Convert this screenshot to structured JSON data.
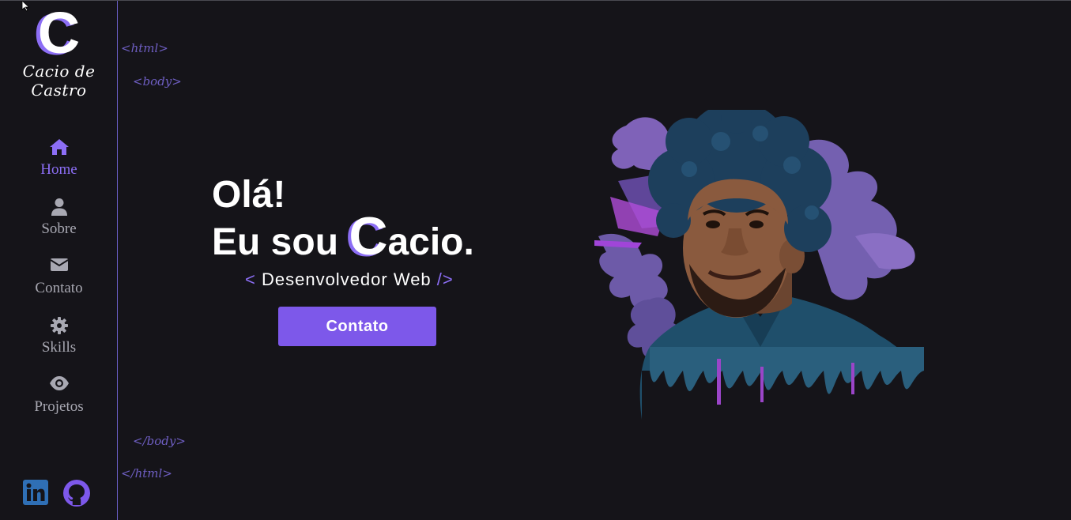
{
  "logo": {
    "letter": "C",
    "name": "Cacio de Castro"
  },
  "nav": {
    "items": [
      {
        "label": "Home",
        "icon": "home-icon",
        "active": true
      },
      {
        "label": "Sobre",
        "icon": "user-icon",
        "active": false
      },
      {
        "label": "Contato",
        "icon": "envelope-icon",
        "active": false
      },
      {
        "label": "Skills",
        "icon": "gear-icon",
        "active": false
      },
      {
        "label": "Projetos",
        "icon": "eye-icon",
        "active": false
      }
    ]
  },
  "social": {
    "linkedin_icon": "linkedin-icon",
    "github_icon": "github-icon"
  },
  "code_tags": {
    "html_open": "<html>",
    "body_open": "<body>",
    "body_close": "</body>",
    "html_close": "</html>"
  },
  "hero": {
    "line1": "Olá!",
    "line2_prefix": "Eu sou ",
    "line2_big": "C",
    "line2_suffix": "acio.",
    "subtitle_open": "< ",
    "subtitle_text": "Desenvolvedor Web",
    "subtitle_close": " />",
    "cta_label": "Contato"
  },
  "colors": {
    "background": "#151419",
    "accent": "#8c6ef5",
    "button": "#7d58ea",
    "nav_text": "#a8a8b2",
    "linkedin": "#2f6fb5"
  }
}
